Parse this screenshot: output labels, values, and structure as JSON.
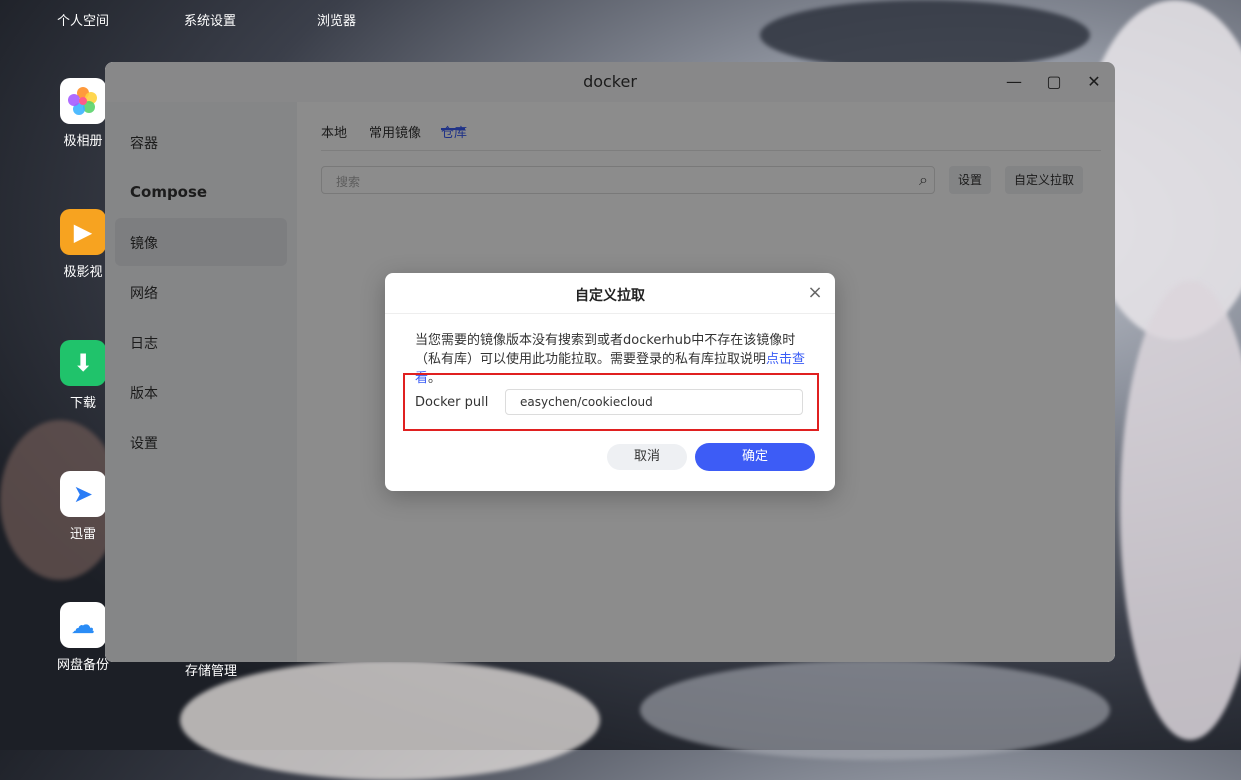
{
  "desktop": {
    "menu": [
      "个人空间",
      "系统设置",
      "浏览器"
    ],
    "icons": [
      {
        "label": "极相册",
        "icon": "photos-icon",
        "color": "#ffffff"
      },
      {
        "label": "极影视",
        "icon": "video-icon",
        "color": "#f7a320"
      },
      {
        "label": "下载",
        "icon": "download-icon",
        "color": "#20c36b"
      },
      {
        "label": "迅雷",
        "icon": "thunder-icon",
        "color": "#ffffff"
      },
      {
        "label": "网盘备份",
        "icon": "cloud-backup-icon",
        "color": "#ffffff"
      },
      {
        "label": "存储管理",
        "icon": "storage-icon",
        "color": "#3a7cf6"
      }
    ]
  },
  "window": {
    "title": "docker",
    "controls": {
      "minimize": "—",
      "maximize": "▢",
      "close": "✕"
    }
  },
  "sidebar": {
    "items": [
      "容器",
      "Compose",
      "镜像",
      "网络",
      "日志",
      "版本",
      "设置"
    ],
    "active": "镜像"
  },
  "tabs": {
    "items": [
      "本地",
      "常用镜像",
      "仓库"
    ],
    "active": "仓库"
  },
  "search": {
    "placeholder": "搜索"
  },
  "buttons": {
    "settings": "设置",
    "custom_pull": "自定义拉取"
  },
  "dialog": {
    "title": "自定义拉取",
    "desc": "当您需要的镜像版本没有搜索到或者dockerhub中不存在该镜像时（私有库）可以使用此功能拉取。需要登录的私有库拉取说明",
    "link": "点击查看",
    "desc_end": "。",
    "label": "Docker pull",
    "input_value": "easychen/cookiecloud",
    "cancel": "取消",
    "confirm": "确定"
  },
  "colors": {
    "accent": "#3a5cf6",
    "highlight": "#e02020"
  }
}
